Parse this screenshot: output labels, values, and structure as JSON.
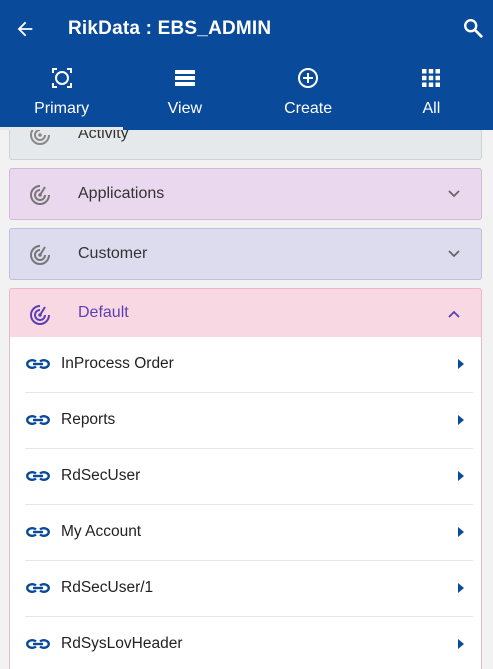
{
  "header": {
    "title": "RikData : EBS_ADMIN",
    "back_icon": "arrow-left-icon",
    "search_icon": "search-icon",
    "background": "#0a4a9a"
  },
  "tabs": [
    {
      "label": "Primary",
      "icon": "target-frame-icon",
      "active": true
    },
    {
      "label": "View",
      "icon": "list-view-icon",
      "active": false
    },
    {
      "label": "Create",
      "icon": "plus-circle-icon",
      "active": false
    },
    {
      "label": "All",
      "icon": "grid-icon",
      "active": false
    }
  ],
  "sections": [
    {
      "label": "Activity",
      "color": "#e6e9eb",
      "expanded": false
    },
    {
      "label": "Applications",
      "color": "#ead8ee",
      "expanded": false
    },
    {
      "label": "Customer",
      "color": "#dcdcee",
      "expanded": false
    },
    {
      "label": "Default",
      "color": "#f8d9e3",
      "expanded": true
    }
  ],
  "default_items": [
    {
      "label": "InProcess Order"
    },
    {
      "label": "Reports"
    },
    {
      "label": "RdSecUser"
    },
    {
      "label": "My Account"
    },
    {
      "label": "RdSecUser/1"
    },
    {
      "label": "RdSysLovHeader"
    }
  ],
  "colors": {
    "accent": "#0a4a9a",
    "link_icon": "#0a4a9a",
    "default_label": "#5b3fb5"
  }
}
